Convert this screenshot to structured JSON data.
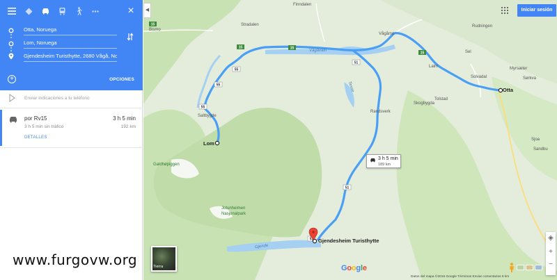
{
  "panel": {
    "waypoints": [
      {
        "label": "Otta, Noruega"
      },
      {
        "label": "Lom, Noruega"
      },
      {
        "label": "Gjendesheim Turisthytte, 2680 Vågå, No"
      }
    ],
    "options_label": "OPCIONES",
    "send_to_phone": "Enviar indicaciones a tu teléfono",
    "route": {
      "via": "por Rv15",
      "time": "3 h 5 min",
      "traffic": "3 h 5 min sin tráfico",
      "distance": "192 km",
      "details": "DETALLES"
    },
    "close_icon": "×",
    "add_icon": "+"
  },
  "map": {
    "signin": "Iniciar sesión",
    "cities": {
      "otta": "Otta",
      "lom": "Lom",
      "gjendesheim": "Gjendesheim Turisthytte"
    },
    "route_box": {
      "time": "3 h 5 min",
      "distance": "189 km"
    },
    "labels": {
      "finndalen": "Finndalen",
      "bismo": "Bismo",
      "stradalen": "Stradalen",
      "vagamo": "Vågåmo",
      "rudningen": "Rudningen",
      "sel": "Sel",
      "lalm": "Lalm",
      "tolstad": "Tolstad",
      "skogbygda": "Skogbygda",
      "randsverk": "Randsverk",
      "sjoa": "Sjoa",
      "sandbu": "Sandbu",
      "myrsaeter": "Myrsæter",
      "sorkva": "Sørkva",
      "saddlestad": "Saddlestad",
      "solvadal": "Solvadal",
      "salt": "Saltbygde",
      "smorbotn": "Smørbotn",
      "jotunheimen": "Jotunheimen\nNasjonalpark",
      "galdhopiggen": "Galdhøpiggen",
      "gjende": "Gjende",
      "tesse": "Tesse",
      "otta_river": "Otta",
      "vaga": "Vågåvatn"
    },
    "road_shields": [
      "15",
      "15",
      "15",
      "15",
      "51",
      "51",
      "51",
      "55",
      "55",
      "55"
    ],
    "google_logo": [
      "G",
      "o",
      "o",
      "g",
      "l",
      "e"
    ],
    "google_colors": [
      "#4285f4",
      "#ea4335",
      "#fbbc05",
      "#4285f4",
      "#34a853",
      "#ea4335"
    ],
    "copyright": "Datos del mapa ©2016 Google   Términos   Enviar comentarios   5 km",
    "earth_label": "Tierra",
    "zoom_in": "+",
    "zoom_out": "−"
  },
  "watermark": "www.furgovw.org",
  "colors": {
    "header_blue": "#4285f4",
    "route_blue": "#4a9ff5",
    "park_green": "#c8e6b4",
    "land": "#e8f0dc",
    "water": "#9ccaf0"
  }
}
